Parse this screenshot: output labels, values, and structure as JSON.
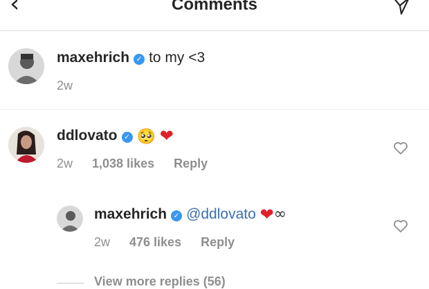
{
  "header": {
    "title": "Comments",
    "back_icon": "chevron-left-icon",
    "direct_icon": "paper-plane-icon"
  },
  "caption": {
    "username": "maxehrich",
    "verified": true,
    "text": "to my <3",
    "time": "2w"
  },
  "comment": {
    "username": "ddlovato",
    "verified": true,
    "emoji_face": "🥺",
    "emoji_heart": "❤",
    "time": "2w",
    "likes": "1,038 likes",
    "reply": "Reply"
  },
  "reply_comment": {
    "username": "maxehrich",
    "verified": true,
    "mention": "@ddlovato",
    "emoji_heart": "❤",
    "infinity": "∞",
    "time": "2w",
    "likes": "476 likes",
    "reply": "Reply"
  },
  "view_more": "View more replies (56)",
  "colors": {
    "verified": "#3897f0",
    "mention": "#3a6fb0",
    "heart": "#e0202a"
  }
}
